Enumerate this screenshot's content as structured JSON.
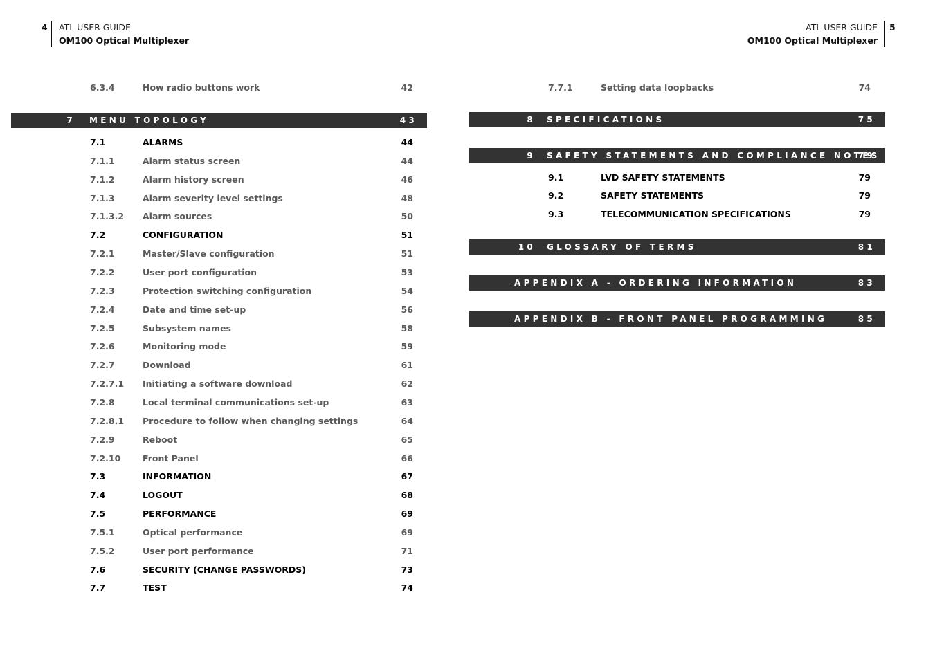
{
  "left_page": {
    "page_number": "4",
    "header": {
      "guide": "ATL USER GUIDE",
      "product": "OM100 Optical Multiplexer"
    },
    "entries_before": [
      {
        "num": "6.3.4",
        "title": "How radio buttons work",
        "page": "42",
        "level": 3
      }
    ],
    "chapter": {
      "num": "7",
      "title": "MENU TOPOLOGY",
      "page": "43"
    },
    "entries": [
      {
        "num": "7.1",
        "title": "ALARMS",
        "page": "44",
        "level": 2
      },
      {
        "num": "7.1.1",
        "title": "Alarm status screen",
        "page": "44",
        "level": 3
      },
      {
        "num": "7.1.2",
        "title": "Alarm history screen",
        "page": "46",
        "level": 3
      },
      {
        "num": "7.1.3",
        "title": "Alarm severity level settings",
        "page": "48",
        "level": 3
      },
      {
        "num": "7.1.3.2",
        "title": "Alarm sources",
        "page": "50",
        "level": 3
      },
      {
        "num": "7.2",
        "title": "CONFIGURATION",
        "page": "51",
        "level": 2
      },
      {
        "num": "7.2.1",
        "title": "Master/Slave configuration",
        "page": "51",
        "level": 3
      },
      {
        "num": "7.2.2",
        "title": "User port configuration",
        "page": "53",
        "level": 3
      },
      {
        "num": "7.2.3",
        "title": "Protection switching configuration",
        "page": "54",
        "level": 3
      },
      {
        "num": "7.2.4",
        "title": "Date and time set-up",
        "page": "56",
        "level": 3
      },
      {
        "num": "7.2.5",
        "title": "Subsystem names",
        "page": "58",
        "level": 3
      },
      {
        "num": "7.2.6",
        "title": "Monitoring mode",
        "page": "59",
        "level": 3
      },
      {
        "num": "7.2.7",
        "title": "Download",
        "page": "61",
        "level": 3
      },
      {
        "num": "7.2.7.1",
        "title": "Initiating a software download",
        "page": "62",
        "level": 3
      },
      {
        "num": "7.2.8",
        "title": "Local terminal communications set-up",
        "page": "63",
        "level": 3
      },
      {
        "num": "7.2.8.1",
        "title": "Procedure to follow when changing settings",
        "page": "64",
        "level": 3
      },
      {
        "num": "7.2.9",
        "title": "Reboot",
        "page": "65",
        "level": 3
      },
      {
        "num": "7.2.10",
        "title": "Front Panel",
        "page": "66",
        "level": 3
      },
      {
        "num": "7.3",
        "title": "INFORMATION",
        "page": "67",
        "level": 2
      },
      {
        "num": "7.4",
        "title": "LOGOUT",
        "page": "68",
        "level": 2
      },
      {
        "num": "7.5",
        "title": "PERFORMANCE",
        "page": "69",
        "level": 2
      },
      {
        "num": "7.5.1",
        "title": "Optical performance",
        "page": "69",
        "level": 3
      },
      {
        "num": "7.5.2",
        "title": "User port performance",
        "page": "71",
        "level": 3
      },
      {
        "num": "7.6",
        "title": "SECURITY (CHANGE PASSWORDS)",
        "page": "73",
        "level": 2
      },
      {
        "num": "7.7",
        "title": "TEST",
        "page": "74",
        "level": 2
      }
    ]
  },
  "right_page": {
    "page_number": "5",
    "header": {
      "guide": "ATL USER GUIDE",
      "product": "OM100 Optical Multiplexer"
    },
    "entries_before": [
      {
        "num": "7.7.1",
        "title": "Setting data loopbacks",
        "page": "74",
        "level": 3
      }
    ],
    "chapters": [
      {
        "num": "8",
        "title": "SPECIFICATIONS",
        "page": "75",
        "entries": []
      },
      {
        "num": "9",
        "title": "SAFETY STATEMENTS AND COMPLIANCE NOTES",
        "page": "79",
        "entries": [
          {
            "num": "9.1",
            "title": "LVD SAFETY STATEMENTS",
            "page": "79",
            "level": 2
          },
          {
            "num": "9.2",
            "title": "SAFETY STATEMENTS",
            "page": "79",
            "level": 2
          },
          {
            "num": "9.3",
            "title": "TELECOMMUNICATION SPECIFICATIONS",
            "page": "79",
            "level": 2
          }
        ]
      },
      {
        "num": "10",
        "title": "GLOSSARY OF TERMS",
        "page": "81",
        "entries": []
      },
      {
        "num": "",
        "title": "APPENDIX A - ORDERING INFORMATION",
        "page": "83",
        "entries": []
      },
      {
        "num": "",
        "title": "APPENDIX B - FRONT PANEL PROGRAMMING",
        "page": "85",
        "entries": []
      }
    ]
  },
  "colors": {
    "chapter_bar": "#333333",
    "chapter_text": "#ffffff",
    "level2_text": "#000000",
    "level3_text": "#5a5a5a"
  }
}
